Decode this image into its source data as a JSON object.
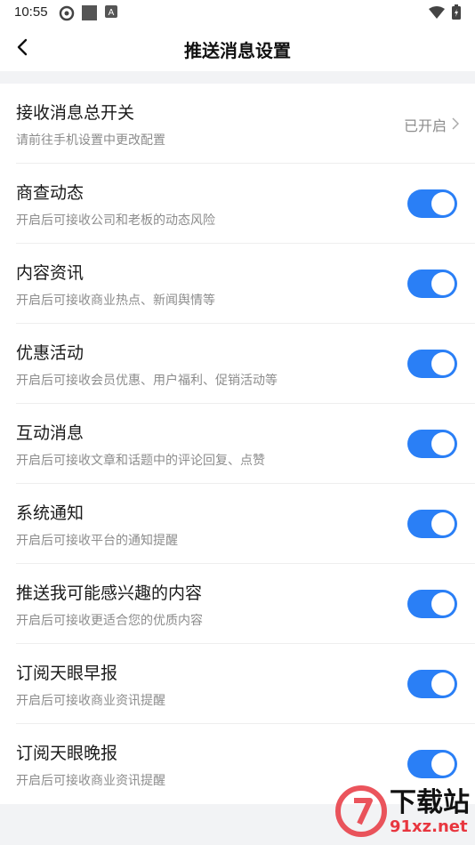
{
  "status_bar": {
    "time": "10:55",
    "icons": [
      "settings-gear-icon",
      "square-icon",
      "a-badge-icon",
      "wifi-icon",
      "battery-icon"
    ]
  },
  "header": {
    "title": "推送消息设置",
    "back_icon": "chevron-left-icon"
  },
  "master_switch": {
    "title": "接收消息总开关",
    "subtitle": "请前往手机设置中更改配置",
    "state": "已开启"
  },
  "settings": [
    {
      "title": "商查动态",
      "subtitle": "开启后可接收公司和老板的动态风险",
      "enabled": true
    },
    {
      "title": "内容资讯",
      "subtitle": "开启后可接收商业热点、新闻舆情等",
      "enabled": true
    },
    {
      "title": "优惠活动",
      "subtitle": "开启后可接收会员优惠、用户福利、促销活动等",
      "enabled": true
    },
    {
      "title": "互动消息",
      "subtitle": "开启后可接收文章和话题中的评论回复、点赞",
      "enabled": true
    },
    {
      "title": "系统通知",
      "subtitle": "开启后可接收平台的通知提醒",
      "enabled": true
    },
    {
      "title": "推送我可能感兴趣的内容",
      "subtitle": "开启后可接收更适合您的优质内容",
      "enabled": true
    },
    {
      "title": "订阅天眼早报",
      "subtitle": "开启后可接收商业资讯提醒",
      "enabled": true
    },
    {
      "title": "订阅天眼晚报",
      "subtitle": "开启后可接收商业资讯提醒",
      "enabled": true
    }
  ],
  "watermark": {
    "logo_text": "下载站",
    "url_text": "91xz.net"
  },
  "colors": {
    "accent": "#2a7ff6",
    "background": "#f2f3f5",
    "watermark_red": "#e8363f"
  }
}
